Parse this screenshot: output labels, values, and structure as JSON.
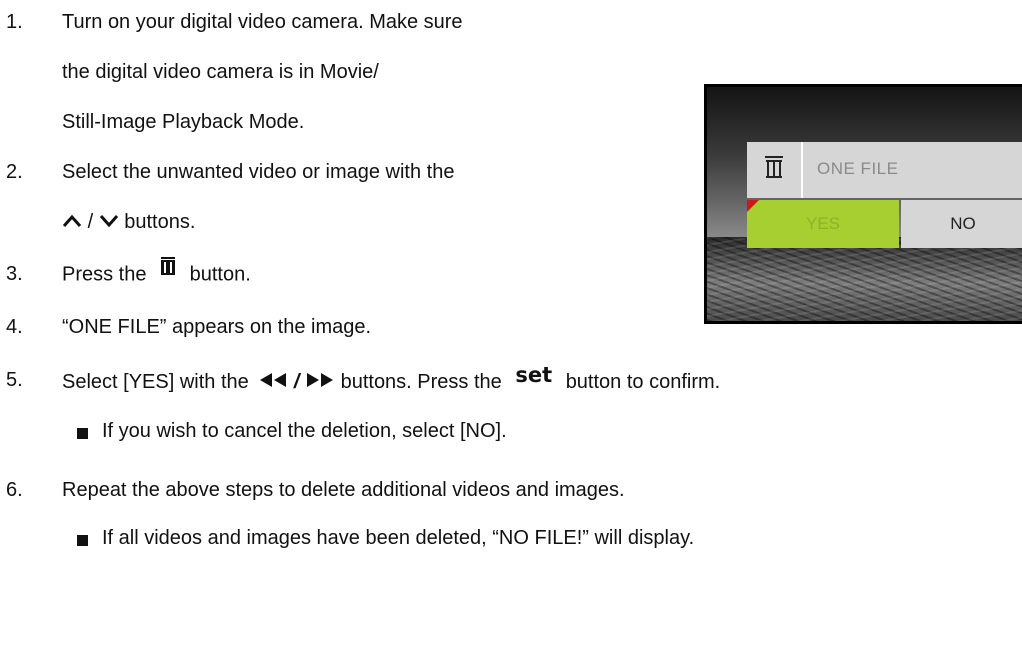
{
  "steps": [
    {
      "num": "1.",
      "lines": [
        "Turn on your digital video camera. Make sure",
        "the digital video camera is in Movie/",
        "Still-Image Playback Mode."
      ]
    },
    {
      "num": "2.",
      "line1": "Select the unwanted video or image with the",
      "line2_sep": "/",
      "line2_end": "buttons."
    },
    {
      "num": "3.",
      "pre": "Press the",
      "post": "button."
    },
    {
      "num": "4.",
      "text": "“ONE FILE” appears on the image."
    },
    {
      "num": "5.",
      "pre": "Select [YES] with the",
      "slash": "/",
      "mid": "buttons. Press the",
      "set_label": "set",
      "post": "button to confirm.",
      "note": "If you wish to cancel the deletion, select [NO]."
    },
    {
      "num": "6.",
      "text": "Repeat the above steps to delete additional videos and images.",
      "note": "If all videos and images have been deleted, “NO FILE!” will display."
    }
  ],
  "icons": {
    "up": "chevron-up-icon",
    "down": "chevron-down-icon",
    "delete": "trash-icon",
    "rewind": "rewind-icon",
    "fast_forward": "fast-forward-icon"
  },
  "screen": {
    "title": "ONE FILE",
    "yes": "YES",
    "no": "NO",
    "colors": {
      "yes_bg": "#a8cf32",
      "panel_bg": "#d6d6d6",
      "marker": "#d01818"
    }
  }
}
